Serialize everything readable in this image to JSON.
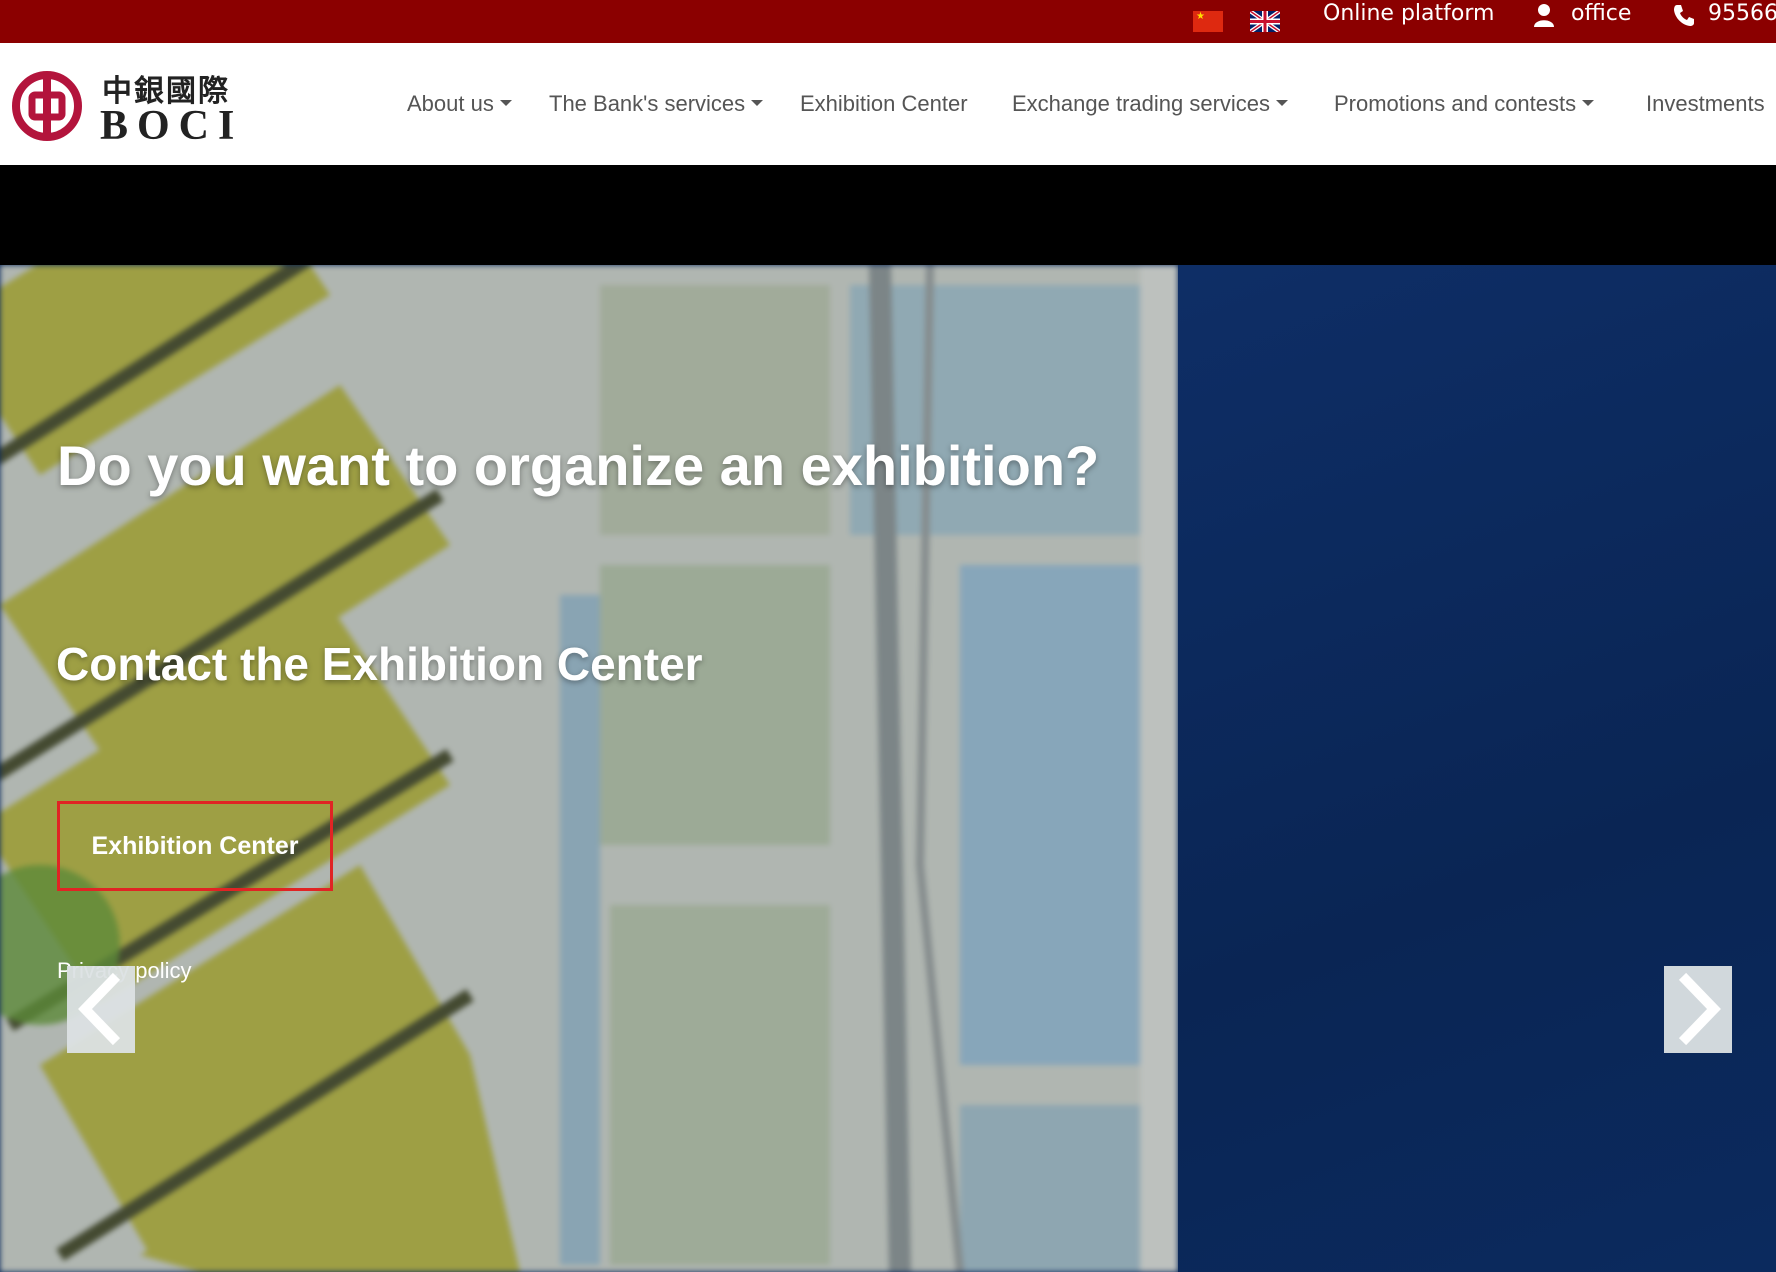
{
  "topbar": {
    "bg_color": "#8b0000",
    "online_platform": "Online platform",
    "office": "office",
    "phone": "95566",
    "icons": [
      "china-flag-icon",
      "uk-flag-icon",
      "user-icon",
      "phone-icon"
    ]
  },
  "header": {
    "logo_cn": "中銀國際",
    "logo_en": "BOCI",
    "nav": [
      {
        "label": "About us",
        "dropdown": true
      },
      {
        "label": "The Bank's services",
        "dropdown": true
      },
      {
        "label": "Exhibition Center",
        "dropdown": false
      },
      {
        "label": "Exchange trading services",
        "dropdown": true
      },
      {
        "label": "Promotions and contests",
        "dropdown": true
      },
      {
        "label": "Investments",
        "dropdown": false
      }
    ]
  },
  "hero": {
    "title": "Do you want to organize an exhibition?",
    "subtitle": "Contact the Exhibition Center",
    "button_label": "Exhibition Center",
    "policy_link": "Privacy policy",
    "button_border_color": "#e02424",
    "right_panel_color": "#0b2a5e"
  }
}
